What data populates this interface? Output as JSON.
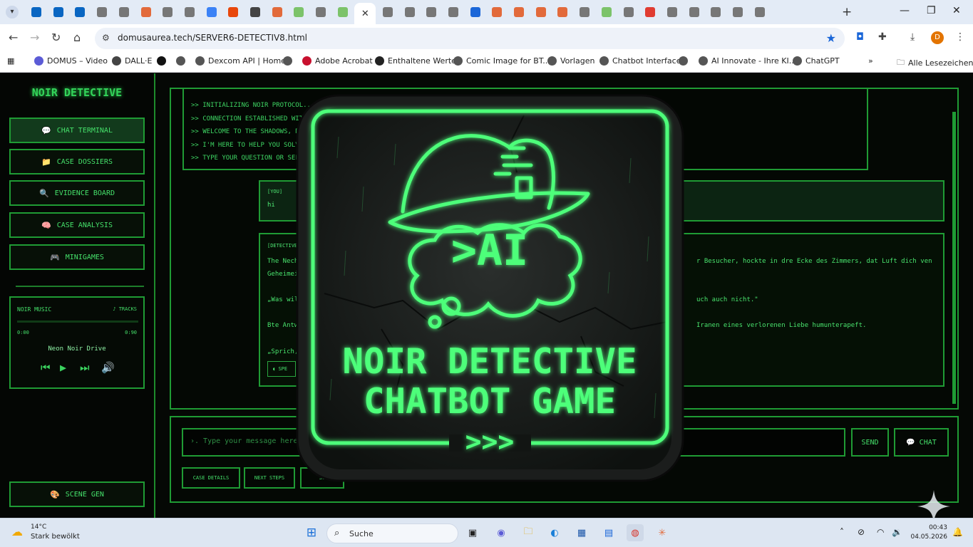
{
  "browser": {
    "url": "domusaurea.tech/SERVER6-DETECTIV8.html",
    "profile_initial": "D",
    "bookmarks": [
      {
        "label": "DOMUS – Video",
        "color": "#5b5bd6"
      },
      {
        "label": "DALL·E",
        "color": "#444444"
      },
      {
        "label": "",
        "color": "#111111"
      },
      {
        "label": "",
        "color": "#555555"
      },
      {
        "label": "Dexcom API | Home",
        "color": "#555555"
      },
      {
        "label": "",
        "color": "#555555"
      },
      {
        "label": "Adobe Acrobat",
        "color": "#c8102e"
      },
      {
        "label": "Enthaltene Werte",
        "color": "#222222"
      },
      {
        "label": "Comic Image for BT...",
        "color": "#555555"
      },
      {
        "label": "Vorlagen",
        "color": "#555555"
      },
      {
        "label": "Chatbot Interface",
        "color": "#555555"
      },
      {
        "label": "",
        "color": "#555555"
      },
      {
        "label": "AI Innovate - Ihre KI...",
        "color": "#555555"
      },
      {
        "label": "ChatGPT",
        "color": "#555555"
      }
    ],
    "all_bookmarks": "Alle Lesezeichen"
  },
  "app": {
    "brand": "NOIR DETECTIVE",
    "nav": [
      {
        "label": "CHAT TERMINAL",
        "icon": "speech-bubble-icon",
        "glyph": "💬"
      },
      {
        "label": "CASE DOSSIERS",
        "icon": "folder-icon",
        "glyph": "📁"
      },
      {
        "label": "EVIDENCE BOARD",
        "icon": "magnifier-icon",
        "glyph": "🔍"
      },
      {
        "label": "CASE ANALYSIS",
        "icon": "brain-icon",
        "glyph": "🧠"
      },
      {
        "label": "MINIGAMES",
        "icon": "gamepad-icon",
        "glyph": "🎮"
      }
    ],
    "music": {
      "title": "NOIR MUSIC",
      "tracks": "♪ TRACKS",
      "time_current": "0:00",
      "time_total": "0:90",
      "song": "Neon Noir Drive",
      "progress": 0
    },
    "scene_gen": {
      "label": "SCENE GEN",
      "glyph": "🎨"
    },
    "system_lines": [
      ">> INITIALIZING NOIR PROTOCOL...",
      ">> CONNECTION ESTABLISHED WITH D",
      ">> WELCOME TO THE SHADOWS, DE",
      ">> I'M HERE TO HELP YOU SOLVE",
      ">> TYPE YOUR QUESTION OR SELE"
    ],
    "user_message": {
      "label": "[YOU]",
      "text": "hi"
    },
    "detective_message": {
      "label": "[DETECTIVE]",
      "line1_left": "The Nech",
      "line1_right": "r Besucher, hockte in dre Ecke des Zimmers, dat Luft dich ven",
      "line2_left": "Geheimei",
      "line3_left": "„Was wil",
      "line3_right": "uch auch nicht.\"",
      "line4_left": "Bte Antw",
      "line4_right": "Iranen eines verlorenen Liebe humunterapeft.",
      "line5_left": "„Sprich,",
      "speak": "SPE"
    },
    "input_placeholder": "›. Type your message here",
    "send_label": "SEND",
    "chat_label": "CHAT",
    "quick_buttons": [
      "CASE DETAILS",
      "NEXT STEPS",
      "SU"
    ]
  },
  "overlay": {
    "ai_text": ">AI",
    "title_line1": "NOIR DETECTIVE",
    "title_line2": "CHATBOT GAME",
    "arrows": ">>>",
    "accent": "#4dff7a"
  },
  "taskbar": {
    "temp": "14°C",
    "weather": "Stark bewölkt",
    "search": "Suche",
    "time": "00:43",
    "date": "04.05.2026"
  }
}
